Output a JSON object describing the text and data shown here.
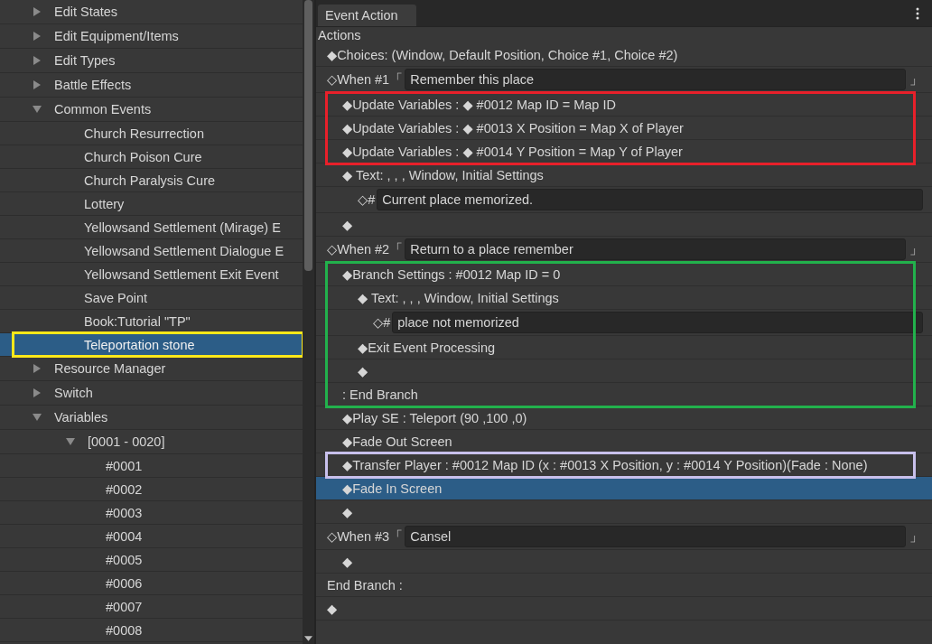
{
  "tree": [
    {
      "label": "Edit States",
      "expanded": false,
      "selected": false
    },
    {
      "label": "Edit Equipment/Items",
      "expanded": false,
      "selected": false
    },
    {
      "label": "Edit Types",
      "expanded": false,
      "selected": false
    },
    {
      "label": "Battle Effects",
      "expanded": false,
      "selected": false
    },
    {
      "label": "Common Events",
      "expanded": true,
      "selected": false,
      "children": [
        {
          "label": "Church Resurrection",
          "selected": false
        },
        {
          "label": "Church Poison Cure",
          "selected": false
        },
        {
          "label": "Church Paralysis Cure",
          "selected": false
        },
        {
          "label": "Lottery",
          "selected": false
        },
        {
          "label": "Yellowsand Settlement (Mirage) E",
          "selected": false
        },
        {
          "label": "Yellowsand Settlement Dialogue E",
          "selected": false
        },
        {
          "label": "Yellowsand Settlement Exit Event",
          "selected": false
        },
        {
          "label": "Save Point",
          "selected": false
        },
        {
          "label": "Book:Tutorial \"TP\"",
          "selected": false
        },
        {
          "label": "Teleportation stone",
          "selected": true,
          "color": "#ffe81a"
        }
      ]
    },
    {
      "label": "Resource Manager",
      "expanded": false,
      "selected": false
    },
    {
      "label": "Switch",
      "expanded": false,
      "selected": false
    },
    {
      "label": "Variables",
      "expanded": true,
      "selected": false,
      "children": [
        {
          "label": "[0001 - 0020]",
          "expanded": true,
          "selected": false,
          "children": [
            {
              "label": "#0001",
              "selected": false
            },
            {
              "label": "#0002",
              "selected": false
            },
            {
              "label": "#0003",
              "selected": false
            },
            {
              "label": "#0004",
              "selected": false
            },
            {
              "label": "#0005",
              "selected": false
            },
            {
              "label": "#0006",
              "selected": false
            },
            {
              "label": "#0007",
              "selected": false
            },
            {
              "label": "#0008",
              "selected": false
            }
          ]
        }
      ]
    }
  ],
  "panel": {
    "tab": "Event Action",
    "section": "Actions"
  },
  "actions": [
    {
      "kind": "command",
      "text": "◆Choices: (Window, Default Position, Choice #1, Choice #2)",
      "selected": false
    },
    {
      "kind": "choice",
      "prefix": "◇When #1「",
      "value": "Remember this place",
      "suffix": "」",
      "selected": false,
      "children": [
        {
          "kind": "frame",
          "color": "#e8202a",
          "children": [
            {
              "kind": "command",
              "text": "◆Update Variables : ◆ #0012 Map ID = Map ID",
              "selected": false
            },
            {
              "kind": "command",
              "text": "◆Update Variables : ◆ #0013 X Position = Map X of Player",
              "selected": false
            },
            {
              "kind": "command",
              "text": "◆Update Variables : ◆ #0014 Y Position = Map Y of Player",
              "selected": false
            }
          ]
        },
        {
          "kind": "command",
          "text": "◆ Text: , , , Window, Initial Settings",
          "selected": false,
          "children": [
            {
              "kind": "message",
              "prefix": "◇#",
              "value": "Current place memorized.",
              "selected": false
            }
          ]
        },
        {
          "kind": "command",
          "text": "◆",
          "selected": false
        }
      ]
    },
    {
      "kind": "choice",
      "prefix": "◇When #2「",
      "value": "Return to a place remember",
      "suffix": "」",
      "selected": false,
      "children": [
        {
          "kind": "frame",
          "color": "#22b14c",
          "children": [
            {
              "kind": "command",
              "text": "◆Branch Settings : #0012 Map ID = 0",
              "selected": false,
              "children": [
                {
                  "kind": "command",
                  "text": "◆ Text: , , , Window, Initial Settings",
                  "selected": false,
                  "children": [
                    {
                      "kind": "message",
                      "prefix": "◇#",
                      "value": "place not memorized",
                      "selected": false
                    }
                  ]
                },
                {
                  "kind": "command",
                  "text": "◆Exit Event Processing",
                  "selected": false
                },
                {
                  "kind": "command",
                  "text": "◆",
                  "selected": false
                }
              ]
            },
            {
              "kind": "command",
              "text": ": End Branch",
              "selected": false
            }
          ]
        },
        {
          "kind": "command",
          "text": "◆Play SE : Teleport (90 ,100 ,0)",
          "selected": false
        },
        {
          "kind": "command",
          "text": "◆Fade Out Screen",
          "selected": false
        },
        {
          "kind": "frame",
          "color": "#c8c0ec",
          "children": [
            {
              "kind": "command",
              "text": "◆Transfer Player : #0012 Map ID (x : #0013 X Position, y : #0014 Y Position)(Fade : None)",
              "selected": false
            }
          ]
        },
        {
          "kind": "command",
          "text": "◆Fade In Screen",
          "selected": true
        },
        {
          "kind": "command",
          "text": "◆",
          "selected": false
        }
      ]
    },
    {
      "kind": "choice",
      "prefix": "◇When #3「",
      "value": "Cansel",
      "suffix": "」",
      "selected": false,
      "children": [
        {
          "kind": "command",
          "text": "◆",
          "selected": false
        }
      ]
    },
    {
      "kind": "command",
      "text": "End Branch :",
      "selected": false
    },
    {
      "kind": "command",
      "text": "◆",
      "selected": false
    }
  ]
}
